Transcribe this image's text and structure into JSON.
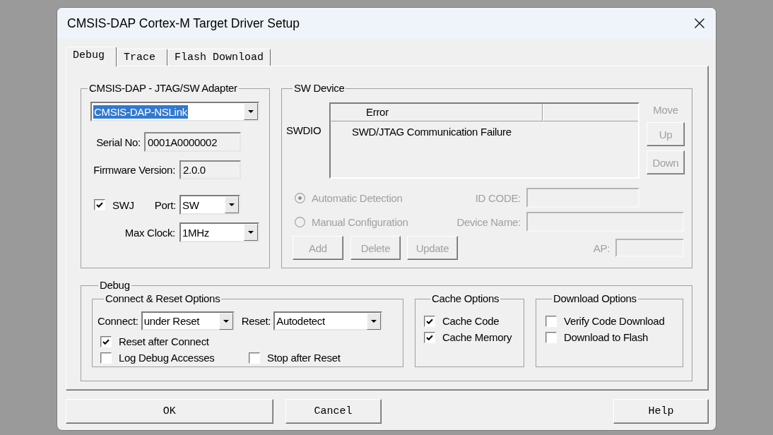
{
  "window": {
    "title": "CMSIS-DAP Cortex-M Target Driver Setup"
  },
  "tabs": [
    {
      "label": "Debug",
      "selected": true
    },
    {
      "label": "Trace",
      "selected": false
    },
    {
      "label": "Flash Download",
      "selected": false
    }
  ],
  "adapter_group": {
    "title": "CMSIS-DAP - JTAG/SW Adapter",
    "adapter": {
      "value": "CMSIS-DAP-NSLink",
      "highlighted": true
    },
    "serial_no": {
      "label": "Serial No:",
      "value": "0001A0000002"
    },
    "firmware_version": {
      "label": "Firmware Version:",
      "value": "2.0.0"
    },
    "swj": {
      "label": "SWJ",
      "checked": true
    },
    "port": {
      "label": "Port:",
      "value": "SW"
    },
    "max_clock": {
      "label": "Max Clock:",
      "value": "1MHz"
    }
  },
  "sw_device_group": {
    "title": "SW Device",
    "row_label": "SWDIO",
    "table": {
      "columns": [
        "Error"
      ],
      "rows": [
        [
          "SWD/JTAG Communication Failure"
        ]
      ]
    },
    "move": {
      "label": "Move",
      "disabled": true,
      "buttons": [
        {
          "label": "Up",
          "disabled": true
        },
        {
          "label": "Down",
          "disabled": true
        }
      ]
    },
    "detection": [
      {
        "label": "Automatic Detection",
        "selected": true,
        "disabled": true
      },
      {
        "label": "Manual Configuration",
        "selected": false,
        "disabled": true
      }
    ],
    "id_code": {
      "label": "ID CODE:",
      "disabled": true
    },
    "device_name": {
      "label": "Device Name:",
      "disabled": true
    },
    "actions": [
      {
        "label": "Add",
        "disabled": true
      },
      {
        "label": "Delete",
        "disabled": true
      },
      {
        "label": "Update",
        "disabled": true
      }
    ],
    "ap": {
      "label": "AP:",
      "disabled": true
    }
  },
  "debug_group": {
    "title": "Debug",
    "connect_reset": {
      "title": "Connect & Reset Options",
      "connect": {
        "label": "Connect:",
        "value": "under Reset"
      },
      "reset": {
        "label": "Reset:",
        "value": "Autodetect"
      },
      "options": [
        {
          "label": "Reset after Connect",
          "checked": true
        },
        {
          "label": "Log Debug Accesses",
          "checked": false
        },
        {
          "label": "Stop after Reset",
          "checked": false
        }
      ]
    },
    "cache_options": {
      "title": "Cache Options",
      "options": [
        {
          "label": "Cache Code",
          "checked": true
        },
        {
          "label": "Cache Memory",
          "checked": true
        }
      ]
    },
    "download_options": {
      "title": "Download Options",
      "options": [
        {
          "label": "Verify Code Download",
          "checked": false
        },
        {
          "label": "Download to Flash",
          "checked": false
        }
      ]
    }
  },
  "buttons": [
    {
      "label": "OK"
    },
    {
      "label": "Cancel"
    },
    {
      "label": "Help"
    }
  ]
}
